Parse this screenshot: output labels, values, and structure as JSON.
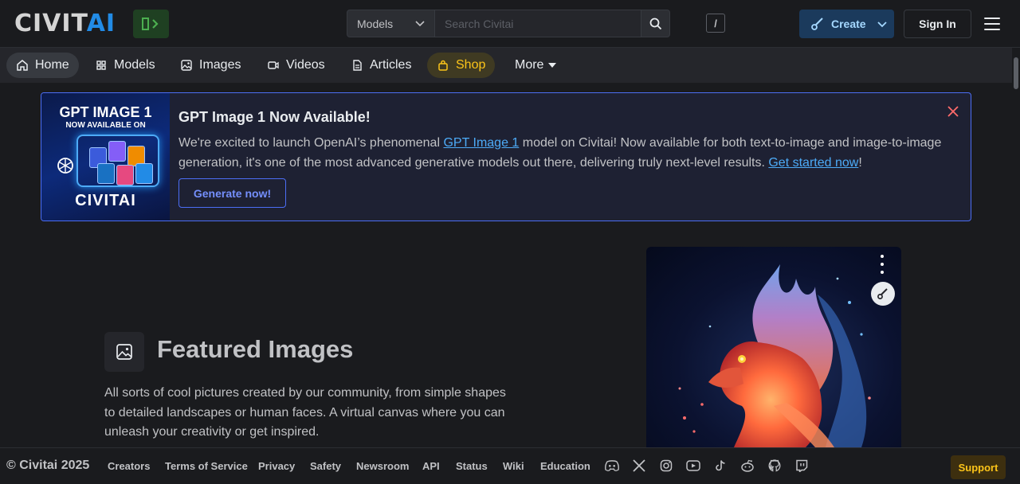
{
  "header": {
    "logo": {
      "part1": "CIVIT",
      "part2": "AI"
    },
    "search": {
      "category": "Models",
      "placeholder": "Search Civitai",
      "shortcut": "/"
    },
    "create_label": "Create",
    "signin_label": "Sign In"
  },
  "nav": {
    "items": [
      {
        "label": "Home",
        "icon": "home-icon"
      },
      {
        "label": "Models",
        "icon": "grid-icon"
      },
      {
        "label": "Images",
        "icon": "image-icon"
      },
      {
        "label": "Videos",
        "icon": "video-icon"
      },
      {
        "label": "Articles",
        "icon": "file-icon"
      },
      {
        "label": "Shop",
        "icon": "bag-icon"
      },
      {
        "label": "More",
        "icon": "caret-down-icon"
      }
    ]
  },
  "announcement": {
    "image": {
      "title": "GPT IMAGE 1",
      "subtitle": "NOW AVAILABLE ON",
      "brand": "CIVITAI"
    },
    "title": "GPT Image 1 Now Available!",
    "body_before": "We're excited to launch OpenAI’s phenomenal ",
    "body_link1": "GPT Image 1",
    "body_middle": " model on Civitai! Now available for both text-to-image and image-to-image generation, it's one of the most advanced generative models out there, delivering truly next-level results. ",
    "body_link2": "Get started now",
    "body_after": "!",
    "button_label": "Generate now!"
  },
  "featured": {
    "title": "Featured Images",
    "description": "All sorts of cool pictures created by our community, from simple shapes to detailed landscapes or human faces. A virtual canvas where you can unleash your creativity or get inspired."
  },
  "footer": {
    "copyright": "© Civitai 2025",
    "links": [
      "Creators",
      "Terms of Service",
      "Privacy",
      "Safety",
      "Newsroom",
      "API",
      "Status",
      "Wiki",
      "Education"
    ],
    "support_label": "Support"
  },
  "colors": {
    "accent": "#228be6",
    "announce_border": "#4c6ef5",
    "shop": "#fcc419",
    "background": "#1a1b1e"
  }
}
